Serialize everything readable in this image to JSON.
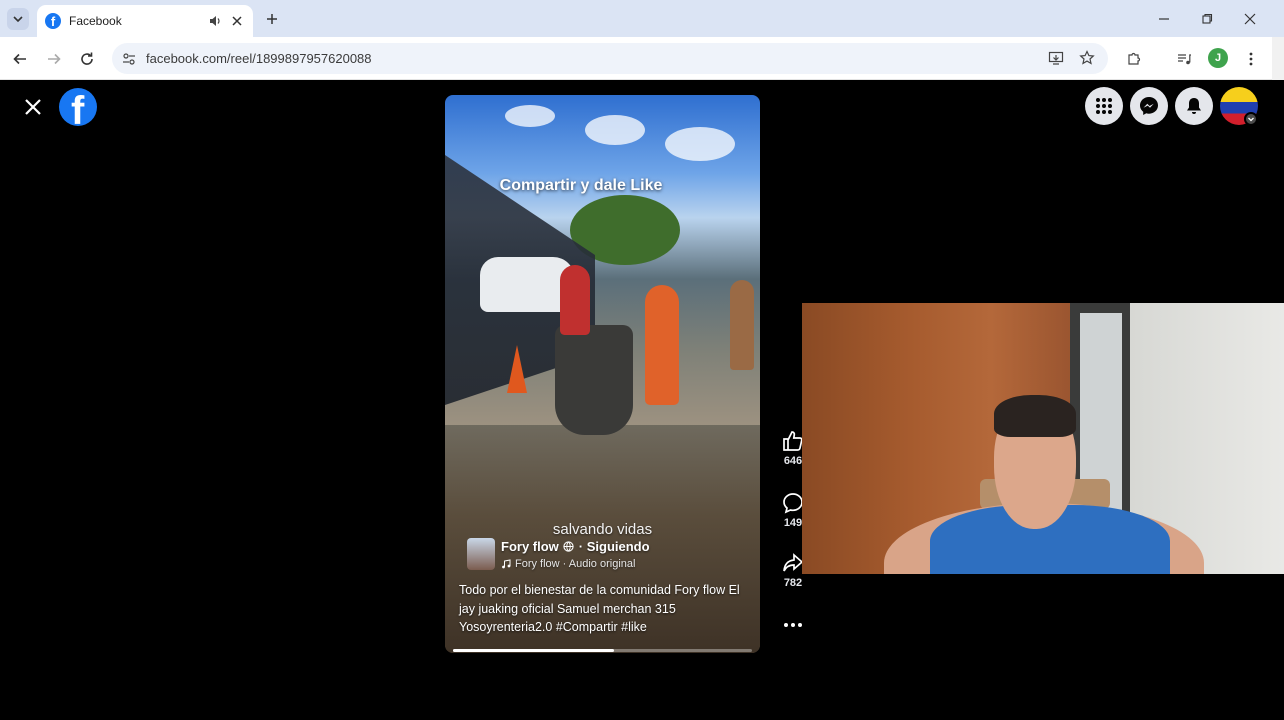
{
  "browser": {
    "tab": {
      "title": "Facebook",
      "favicon_letter": "f"
    },
    "address_bar": {
      "url": "facebook.com/reel/1899897957620088"
    },
    "profile_initial": "J"
  },
  "facebook": {
    "logo_letter": "f"
  },
  "reel": {
    "overlay_text": "Compartir y dale Like",
    "subtitle": "salvando vidas",
    "author": "Fory flow",
    "follow_status": "· Siguiendo",
    "audio": "Fory flow · Audio original",
    "description": "Todo por el bienestar de la comunidad  Fory flow El jay juaking oficial Samuel merchan 315 Yosoyrenteria2.0 #Compartir #like",
    "progress": 0.54,
    "actions": {
      "likes": "646",
      "comments": "149",
      "shares": "782"
    }
  },
  "colors": {
    "facebook_blue": "#1877f2",
    "page_background": "#000000",
    "chrome_tabstrip": "#dbe4f4"
  }
}
